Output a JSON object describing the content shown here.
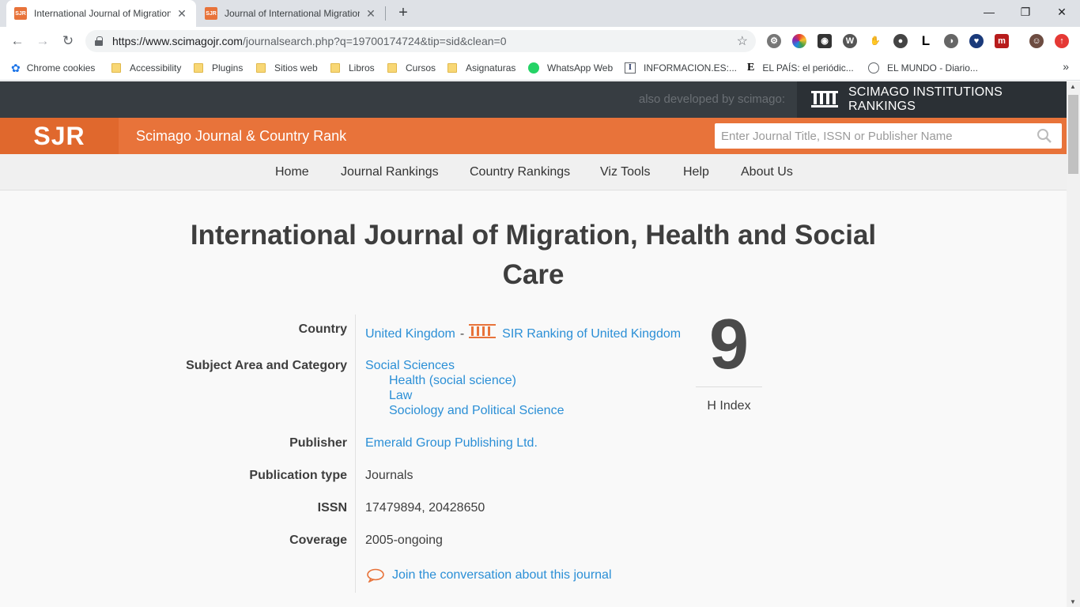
{
  "browser": {
    "tabs": [
      {
        "title": "International Journal of Migration",
        "favicon": "SJR"
      },
      {
        "title": "Journal of International Migration",
        "favicon": "SJR"
      }
    ],
    "url_host": "https://www.scimagojr.com",
    "url_path": "/journalsearch.php?q=19700174724&tip=sid&clean=0",
    "bookmarks": [
      {
        "label": "Chrome cookies",
        "icon": "gear-icon"
      },
      {
        "label": "Accessibility",
        "icon": "folder-icon"
      },
      {
        "label": "Plugins",
        "icon": "folder-icon"
      },
      {
        "label": "Sitios web",
        "icon": "folder-icon"
      },
      {
        "label": "Libros",
        "icon": "folder-icon"
      },
      {
        "label": "Cursos",
        "icon": "folder-icon"
      },
      {
        "label": "Asignaturas",
        "icon": "folder-icon"
      },
      {
        "label": "WhatsApp Web",
        "icon": "whatsapp-icon"
      },
      {
        "label": "INFORMACION.ES:...",
        "icon": "informacion-icon"
      },
      {
        "label": "EL PAÍS: el periódic...",
        "icon": "elpais-icon"
      },
      {
        "label": "EL MUNDO - Diario...",
        "icon": "globe-icon"
      }
    ]
  },
  "site": {
    "also_developed": "also developed by scimago:",
    "sir_label": "SCIMAGO INSTITUTIONS RANKINGS",
    "logo": "SJR",
    "title": "Scimago Journal & Country Rank",
    "search_placeholder": "Enter Journal Title, ISSN or Publisher Name",
    "menu": [
      "Home",
      "Journal Rankings",
      "Country Rankings",
      "Viz Tools",
      "Help",
      "About Us"
    ]
  },
  "journal": {
    "title": "International Journal of Migration, Health and Social Care",
    "labels": {
      "country": "Country",
      "subject": "Subject Area and Category",
      "publisher": "Publisher",
      "pubtype": "Publication type",
      "issn": "ISSN",
      "coverage": "Coverage"
    },
    "country": "United Kingdom",
    "country_sep": "-",
    "sir_ranking": "SIR Ranking of United Kingdom",
    "subject_area": "Social Sciences",
    "categories": [
      "Health (social science)",
      "Law",
      "Sociology and Political Science"
    ],
    "publisher": "Emerald Group Publishing Ltd.",
    "publication_type": "Journals",
    "issn": "17479894, 20428650",
    "coverage": "2005-ongoing",
    "h_index": "9",
    "h_index_label": "H Index",
    "conversation": "Join the conversation about this journal"
  }
}
